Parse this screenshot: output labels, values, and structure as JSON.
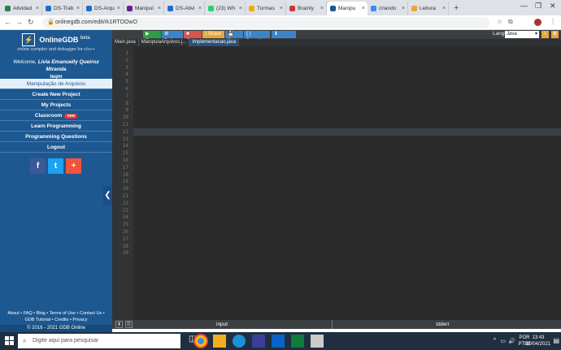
{
  "browser": {
    "tabs": [
      {
        "label": "Atividad",
        "color": "#2d7d46"
      },
      {
        "label": "DS-Trab",
        "color": "#1e6ec8"
      },
      {
        "label": "DS-Arqu",
        "color": "#1e6ec8"
      },
      {
        "label": "Manipul",
        "color": "#6a1b9a"
      },
      {
        "label": "DS-Ativi",
        "color": "#1e6ec8"
      },
      {
        "label": "(23) Wh",
        "color": "#25d366"
      },
      {
        "label": "Turmas",
        "color": "#e8b200"
      },
      {
        "label": "Brainly",
        "color": "#cc3333"
      },
      {
        "label": "Manipu",
        "color": "#1d5891"
      },
      {
        "label": "criando",
        "color": "#4285f4"
      },
      {
        "label": "Leitura",
        "color": "#e8a63c"
      }
    ],
    "active_tab_index": 8,
    "url": "onlinegdb.com/edit/rk1RTOOwO"
  },
  "sidebar": {
    "brand": "OnlineGDB",
    "beta": "beta",
    "tagline": "online compiler and debugger for c/c++",
    "welcome_prefix": "Welcome,",
    "welcome_name": "Livia Emanuelly Queiroz Miranda",
    "welcome_user": "leqm",
    "menu": [
      {
        "label": "Manipulação de Arquivos",
        "selected": true
      },
      {
        "label": "Create New Project"
      },
      {
        "label": "My Projects"
      },
      {
        "label": "Classroom",
        "badge": "new"
      },
      {
        "label": "Learn Programming"
      },
      {
        "label": "Programming Questions"
      },
      {
        "label": "Logout"
      }
    ],
    "social": [
      "f",
      "t",
      "+"
    ],
    "footer_line1": "About • FAQ • Blog • Terms of Use • Contact Us •",
    "footer_line2": "GDB Tutorial • Credits • Privacy",
    "copyright": "© 2016 - 2021 GDB Online"
  },
  "toolbar": {
    "buttons": [
      {
        "label": "▶ Run",
        "color": "#2e9e44"
      },
      {
        "label": "⚙ Debug",
        "color": "#3a85c8"
      },
      {
        "label": "■ Stop",
        "color": "#d9534f"
      },
      {
        "label": "⟨ Share",
        "color": "#e8a63c"
      },
      {
        "label": "💾 Save",
        "color": "#3a85c8"
      },
      {
        "label": "{ } Beautify",
        "color": "#3a85c8"
      },
      {
        "label": "⬇",
        "color": "#3a85c8"
      }
    ],
    "language_label": "Language",
    "language_value": "Java"
  },
  "file_tabs": [
    {
      "label": "Main.java",
      "active": false
    },
    {
      "label": "ManipulaArquivos.j...",
      "active": false
    },
    {
      "label": "Implementacao.java",
      "active": true
    }
  ],
  "code": {
    "line_numbers": [
      "1",
      "2",
      "3",
      "4",
      "5",
      "6",
      "7",
      "8",
      "9",
      "10",
      "11",
      "12",
      "13",
      "14",
      "15",
      "16",
      "17",
      "18",
      "19",
      "20",
      "21",
      "22",
      "23",
      "24",
      "25",
      "26",
      "27",
      "28",
      "29"
    ],
    "highlight_line": 12
  },
  "io": {
    "input_label": "input",
    "stderr_label": "stderr"
  },
  "taskbar": {
    "search_placeholder": "Digite aqui para pesquisar",
    "lang_top": "POR",
    "lang_bottom": "PTB2",
    "time": "13:43",
    "date": "30/04/2021"
  }
}
